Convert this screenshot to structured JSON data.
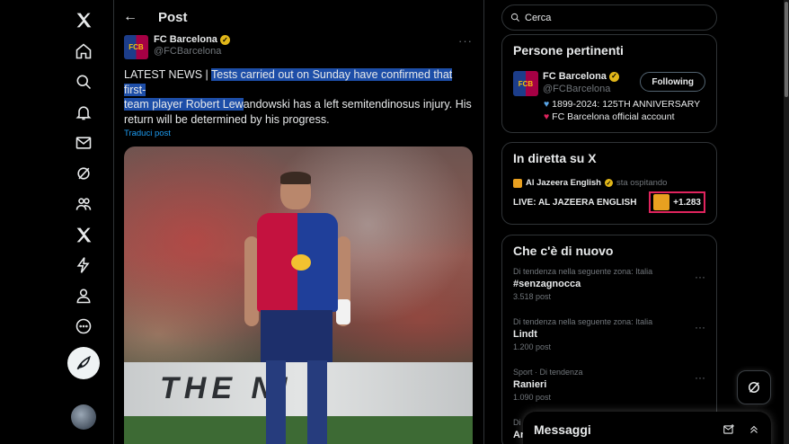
{
  "nav": {
    "items": [
      "x-logo",
      "home",
      "search",
      "notifications",
      "messages",
      "grok",
      "communities",
      "premium",
      "verified-orgs",
      "profile",
      "more"
    ],
    "post_button": "post"
  },
  "header": {
    "title": "Post"
  },
  "tweet": {
    "author_name": "FC Barcelona",
    "author_handle": "@FCBarcelona",
    "text_plain_before": "LATEST NEWS | ",
    "text_highlight_1": "Tests carried out on Sunday have confirmed that first-",
    "text_highlight_2": "team player Robert Lew",
    "text_after": "andowski has a left  semitendinosus injury. His return will be determined by his progress.",
    "translate_link": "Traduci post",
    "media_board_text": "THE NI"
  },
  "search": {
    "placeholder": "Cerca"
  },
  "people": {
    "title": "Persone pertinenti",
    "name": "FC Barcelona",
    "handle": "@FCBarcelona",
    "follow_label": "Following",
    "bio_line_1": "1899-2024: 125TH ANNIVERSARY",
    "bio_line_2": "FC Barcelona official account"
  },
  "live": {
    "title": "In diretta su X",
    "host": "Al Jazeera English",
    "status": "sta ospitando",
    "stream_name": "LIVE: AL JAZEERA ENGLISH",
    "listeners": "+1.283"
  },
  "trends": {
    "title": "Che c'è di nuovo",
    "items": [
      {
        "meta": "Di tendenza nella seguente zona: Italia",
        "name": "#senzagnocca",
        "count": "3.518 post"
      },
      {
        "meta": "Di tendenza nella seguente zona: Italia",
        "name": "Lindt",
        "count": "1.200 post"
      },
      {
        "meta": "Sport · Di tendenza",
        "name": "Ranieri",
        "count": "1.090 post"
      },
      {
        "meta": "Di",
        "name": "An",
        "count": ""
      }
    ]
  },
  "messages": {
    "title": "Messaggi"
  },
  "colors": {
    "accent": "#1d9bf0",
    "highlight": "#1d4ea8",
    "live_border": "#e0245e",
    "gold_badge": "#e2b719"
  }
}
